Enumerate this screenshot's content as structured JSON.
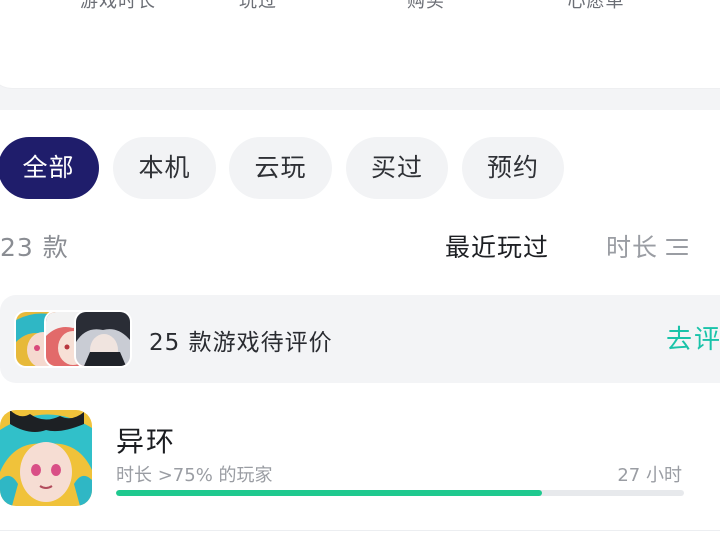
{
  "stats": [
    {
      "label": "游戏时长"
    },
    {
      "label": "玩过"
    },
    {
      "label": "购买"
    },
    {
      "label": "心愿单"
    }
  ],
  "filters": [
    {
      "label": "全部",
      "active": true
    },
    {
      "label": "本机",
      "active": false
    },
    {
      "label": "云玩",
      "active": false
    },
    {
      "label": "买过",
      "active": false
    },
    {
      "label": "预约",
      "active": false
    }
  ],
  "list_header": {
    "count": "23 款",
    "sort_recent": "最近玩过",
    "sort_duration": "时长"
  },
  "review_banner": {
    "text": "25 款游戏待评价",
    "action": "去评"
  },
  "games": [
    {
      "name": "异环",
      "meta": "时长 >75% 的玩家",
      "hours": "27 小时",
      "progress": 0.75
    }
  ],
  "colors": {
    "accent_active_chip": "#1f1d6b",
    "link": "#19c3a9",
    "progress": "#1fc98f"
  }
}
